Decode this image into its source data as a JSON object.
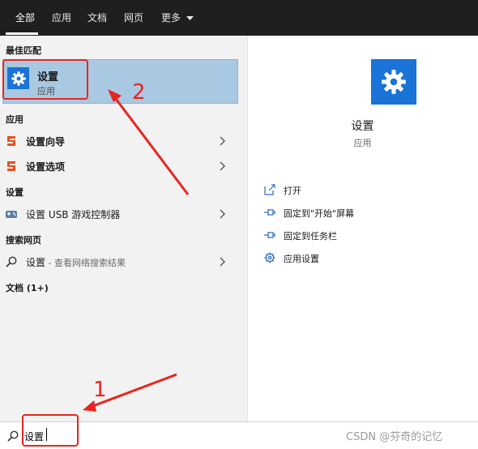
{
  "tabs": [
    "全部",
    "应用",
    "文档",
    "网页",
    "更多"
  ],
  "left": {
    "best_match_header": "最佳匹配",
    "best_match": {
      "title": "设置",
      "subtitle": "应用"
    },
    "apps_header": "应用",
    "apps": [
      "设置向导",
      "设置选项"
    ],
    "settings_header": "设置",
    "settings_item": "设置 USB 游戏控制器",
    "web_header": "搜索网页",
    "web_item": {
      "label": "设置",
      "hint": " - 查看网络搜索结果"
    },
    "docs_header": "文档 (1+)"
  },
  "right": {
    "app_name": "设置",
    "app_type": "应用",
    "actions": [
      "打开",
      "固定到\"开始\"屏幕",
      "固定到任务栏",
      "应用设置"
    ]
  },
  "search": {
    "value": "设置"
  },
  "annotations": {
    "marker1": "1",
    "marker2": "2",
    "color": "#e8251f"
  },
  "watermark": "CSDN @芬奇的记忆",
  "colors": {
    "tile_blue": "#1a73d6",
    "selection": "#a9c9e3",
    "topbar": "#1f1f1f"
  }
}
